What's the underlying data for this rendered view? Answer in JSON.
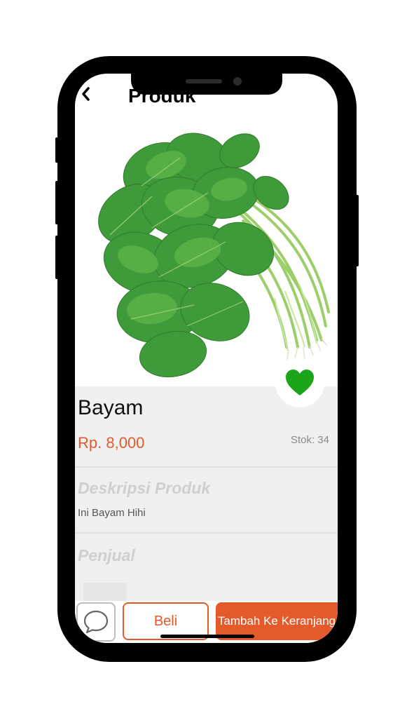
{
  "header": {
    "back_icon": "chevron-left-icon",
    "title": "Produk"
  },
  "product": {
    "image": "spinach-bunch-photo",
    "name": "Bayam",
    "price": "Rp. 8,000",
    "stock": "Stok: 34",
    "favorite_icon": "heart-icon",
    "favorite_color": "#1aa51a"
  },
  "sections": {
    "description_heading": "Deskripsi Produk",
    "description_text": "Ini Bayam Hihi",
    "seller_heading": "Penjual"
  },
  "actions": {
    "chat_icon": "chat-bubble-icon",
    "buy_label": "Beli",
    "cart_label": "Tambah Ke Keranjang"
  },
  "colors": {
    "accent": "#e55a2a",
    "panel_background": "#f0f0f0",
    "heading_muted": "#cfcfcf"
  }
}
